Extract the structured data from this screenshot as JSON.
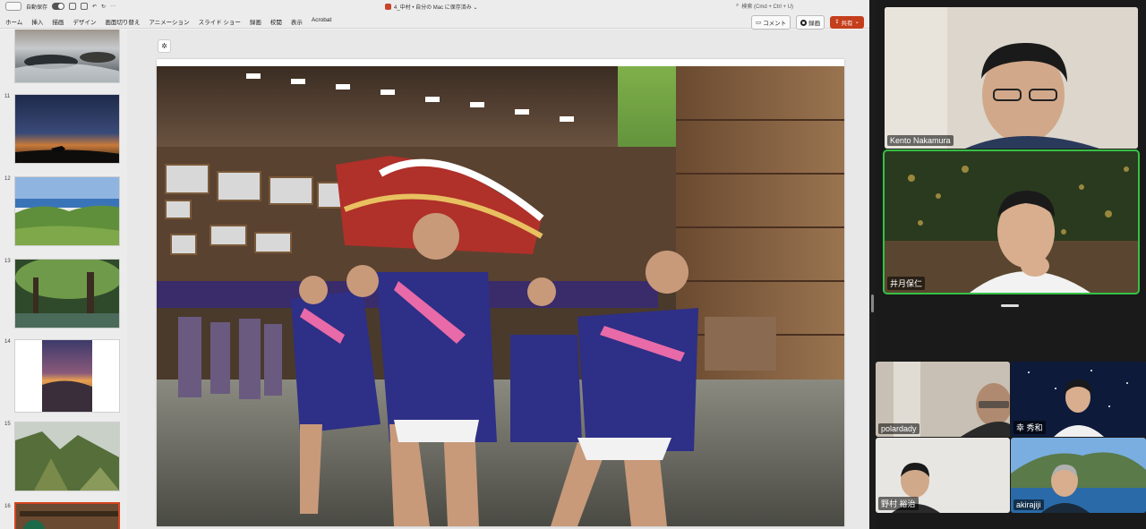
{
  "titlebar": {
    "autosave_label": "自動保存",
    "doc_title": "4_中村 • 自分の Mac に保存済み ⌄",
    "search_placeholder": "検索 (Cmd + Ctrl + U)"
  },
  "ribbon": {
    "tabs": [
      "ホーム",
      "挿入",
      "描画",
      "デザイン",
      "画面切り替え",
      "アニメーション",
      "スライド ショー",
      "録画",
      "校閲",
      "表示",
      "Acrobat"
    ],
    "comment_label": "コメント",
    "record_label": "録画",
    "share_label": "共有"
  },
  "thumbnails": [
    {
      "num": "",
      "scene": "waterfall"
    },
    {
      "num": "11",
      "scene": "sunset-horse"
    },
    {
      "num": "12",
      "scene": "coast"
    },
    {
      "num": "13",
      "scene": "forest"
    },
    {
      "num": "14",
      "scene": "dusk-portrait"
    },
    {
      "num": "15",
      "scene": "cliffs"
    },
    {
      "num": "16",
      "scene": "festival"
    }
  ],
  "participants": [
    {
      "name": "Kento Nakamura"
    },
    {
      "name": "井月保仁"
    },
    {
      "name": "polardady"
    },
    {
      "name": "幸 秀和"
    },
    {
      "name": "野村 裕治"
    },
    {
      "name": "akirajiji"
    }
  ],
  "colors": {
    "accent": "#c43e1c",
    "active_speaker": "#36c146",
    "happi_blue": "#2e2f86",
    "sash_pink": "#e86aa8"
  }
}
